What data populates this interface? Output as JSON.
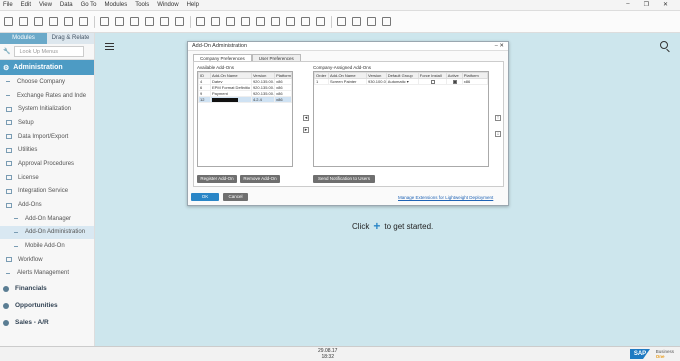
{
  "menubar": {
    "items": [
      "File",
      "Edit",
      "View",
      "Data",
      "Go To",
      "Modules",
      "Tools",
      "Window",
      "Help"
    ]
  },
  "sidebar": {
    "tabs": [
      "Modules",
      "Drag & Relate"
    ],
    "search_placeholder": "Look Up Menus",
    "section": "Administration",
    "items": [
      {
        "label": "Choose Company",
        "kind": "sub-dash"
      },
      {
        "label": "Exchange Rates and Inde",
        "kind": "sub-dash"
      },
      {
        "label": "System Initialization",
        "kind": "folder"
      },
      {
        "label": "Setup",
        "kind": "folder"
      },
      {
        "label": "Data Import/Export",
        "kind": "folder"
      },
      {
        "label": "Utilities",
        "kind": "folder"
      },
      {
        "label": "Approval Procedures",
        "kind": "folder"
      },
      {
        "label": "License",
        "kind": "folder"
      },
      {
        "label": "Integration Service",
        "kind": "folder"
      },
      {
        "label": "Add-Ons",
        "kind": "folder"
      },
      {
        "label": "Add-On Manager",
        "kind": "sub2"
      },
      {
        "label": "Add-On Administration",
        "kind": "sub2-sel"
      },
      {
        "label": "Mobile Add-On",
        "kind": "sub2"
      },
      {
        "label": "Workflow",
        "kind": "folder"
      },
      {
        "label": "Alerts Management",
        "kind": "sub-dash"
      }
    ],
    "modules": [
      "Financials",
      "Opportunities",
      "Sales - A/R"
    ]
  },
  "main": {
    "hint_prefix": "Click",
    "hint_suffix": "to get started."
  },
  "dialog": {
    "title": "Add-On Administration",
    "tabs": [
      "Company Preferences",
      "User Preferences"
    ],
    "available_label": "Available Add-Ons",
    "available_columns": [
      "ID",
      "Add-On Name",
      "Version",
      "Platform"
    ],
    "available_rows": [
      {
        "id": "4",
        "name": "Datev",
        "version": "920.135.00.",
        "platform": "x86"
      },
      {
        "id": "6",
        "name": "EPM Format Definitio",
        "version": "920.135.00.",
        "platform": "x86"
      },
      {
        "id": "9",
        "name": "Payment",
        "version": "920.135.00.",
        "platform": "x86"
      },
      {
        "id": "12",
        "name": "",
        "version": "4.2.4",
        "platform": "x86"
      }
    ],
    "assigned_label": "Company-Assigned Add-Ons",
    "assigned_columns": [
      "Order",
      "Add-On Name",
      "Version",
      "Default Group",
      "Force Install",
      "Active",
      "Platform"
    ],
    "assigned_rows": [
      {
        "order": "1",
        "name": "Screen Painter",
        "version": "930.100.0",
        "group": "Automatic",
        "force": false,
        "active": true,
        "platform": "x86"
      }
    ],
    "register_button": "Register Add-On",
    "remove_button": "Remove Add-On",
    "notify_button": "Send Notification to Users",
    "ok_button": "OK",
    "cancel_button": "Cancel",
    "manage_link": "Manage Extensions for Lightweight Deployment"
  },
  "status": {
    "date": "29.08.17",
    "time": "18:32",
    "brand_text": "SAP",
    "brand_line1": "Business",
    "brand_line2": "One"
  }
}
